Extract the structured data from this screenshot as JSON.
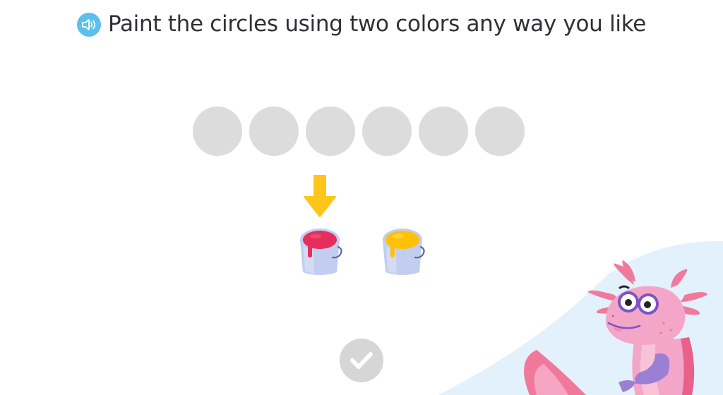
{
  "instruction": {
    "text": "Paint the circles using two colors any way you like",
    "audio_icon": "speaker-icon"
  },
  "circles": [
    {
      "color": "#dcdcdc"
    },
    {
      "color": "#dcdcdc"
    },
    {
      "color": "#dcdcdc"
    },
    {
      "color": "#dcdcdc"
    },
    {
      "color": "#dcdcdc"
    },
    {
      "color": "#dcdcdc"
    }
  ],
  "selection_arrow": {
    "color": "#ffc61a",
    "points_to": "red-paint-bucket"
  },
  "paint_buckets": [
    {
      "name": "red-paint-bucket",
      "paint_color": "#e62e5a",
      "bucket_color": "#c2cdf0"
    },
    {
      "name": "yellow-paint-bucket",
      "paint_color": "#ffc107",
      "bucket_color": "#c2cdf0"
    }
  ],
  "submit": {
    "icon": "checkmark-icon",
    "state": "disabled"
  },
  "mascot": {
    "character": "axolotl",
    "color": "#f4a6c8"
  },
  "colors": {
    "accent_blue": "#5bc0eb",
    "corner_background": "#e3f1fd"
  }
}
